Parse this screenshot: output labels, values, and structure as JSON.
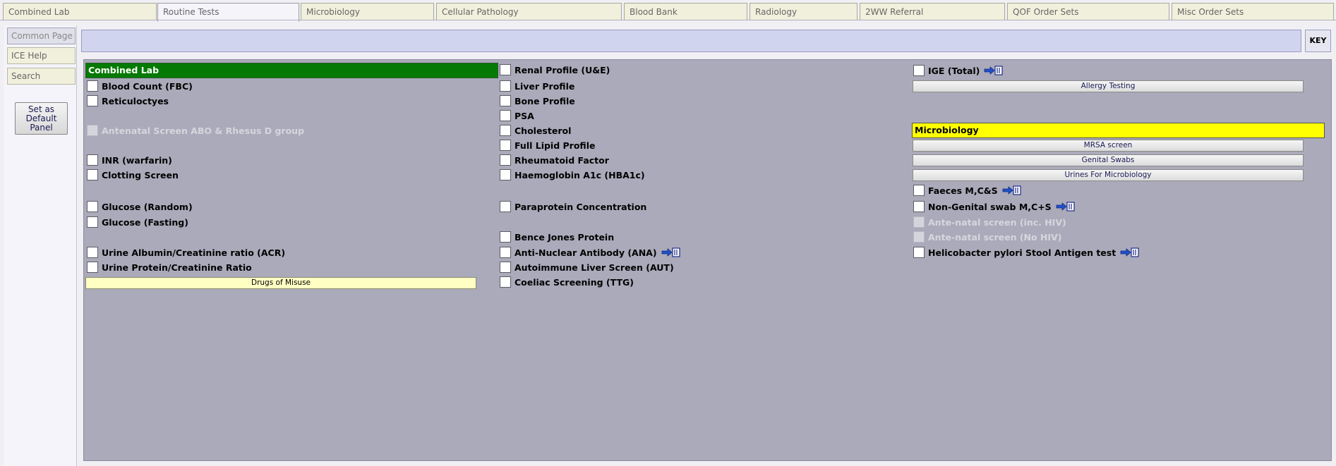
{
  "tabs": [
    {
      "label": "Combined Lab"
    },
    {
      "label": "Routine Tests"
    },
    {
      "label": "Microbiology"
    },
    {
      "label": "Cellular Pathology"
    },
    {
      "label": "Blood Bank"
    },
    {
      "label": "Radiology"
    },
    {
      "label": "2WW Referral"
    },
    {
      "label": "QOF Order Sets"
    },
    {
      "label": "Misc Order Sets"
    }
  ],
  "active_tab": "Routine Tests",
  "sidebar": {
    "items": [
      {
        "label": "Common Page"
      },
      {
        "label": "ICE Help"
      },
      {
        "label": "Search"
      }
    ],
    "default_button": "Set as Default Panel"
  },
  "key_label": "KEY",
  "col1": {
    "header": "Combined Lab",
    "tests": [
      {
        "label": "Blood Count (FBC)"
      },
      {
        "label": "Reticuloctyes"
      },
      {
        "label": "Antenatal Screen ABO & Rhesus D group"
      },
      {
        "label": "INR (warfarin)"
      },
      {
        "label": "Clotting Screen"
      },
      {
        "label": "Glucose (Random)"
      },
      {
        "label": "Glucose (Fasting)"
      },
      {
        "label": "Urine Albumin/Creatinine ratio (ACR)"
      },
      {
        "label": "Urine Protein/Creatinine Ratio"
      }
    ],
    "panel_button": "Drugs of Misuse"
  },
  "col2": {
    "tests": [
      {
        "label": "Renal Profile (U&E)"
      },
      {
        "label": "Liver Profile"
      },
      {
        "label": "Bone Profile"
      },
      {
        "label": "PSA"
      },
      {
        "label": "Cholesterol"
      },
      {
        "label": "Full Lipid Profile"
      },
      {
        "label": "Rheumatoid Factor"
      },
      {
        "label": "Haemoglobin A1c (HBA1c)"
      },
      {
        "label": "Paraprotein Concentration"
      },
      {
        "label": "Bence Jones Protein"
      },
      {
        "label": "Anti-Nuclear Antibody (ANA)"
      },
      {
        "label": "Autoimmune Liver Screen (AUT)"
      },
      {
        "label": "Coeliac Screening (TTG)"
      }
    ]
  },
  "col3": {
    "ige": {
      "label": "IGE (Total)"
    },
    "allergy_button": "Allergy Testing",
    "micro_header": "Microbiology",
    "micro_buttons": [
      "MRSA screen",
      "Genital Swabs",
      "Urines For Microbiology"
    ],
    "tests": [
      {
        "label": "Faeces M,C&S"
      },
      {
        "label": "Non-Genital swab M,C+S"
      },
      {
        "label": "Ante-natal screen (inc. HIV)"
      },
      {
        "label": "Ante-natal screen (No HIV)"
      },
      {
        "label": "Helicobacter pylori Stool Antigen test"
      }
    ]
  },
  "icons": {
    "info": "arrow-book-icon"
  },
  "colors": {
    "combined_lab_header": "#047a04",
    "microbiology_header": "#ffff00",
    "panel_background": "#aaaaba"
  }
}
